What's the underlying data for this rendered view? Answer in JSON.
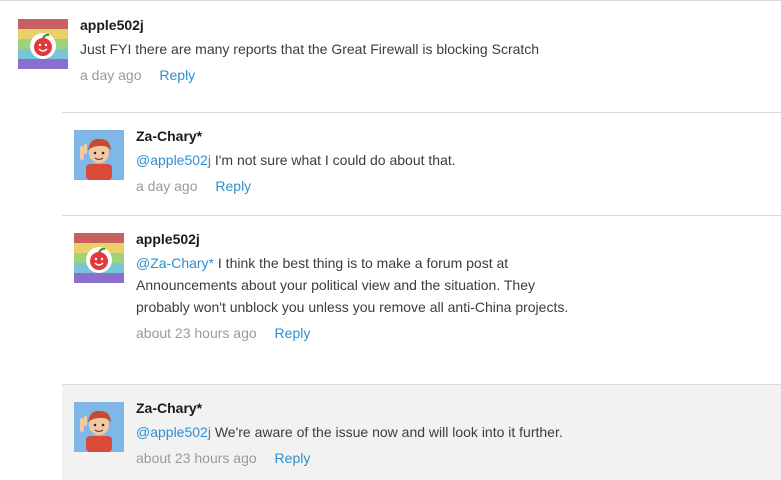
{
  "comments": {
    "top": {
      "username": "apple502j",
      "text": "Just FYI there are many reports that the Great Firewall is blocking Scratch",
      "time": "a day ago",
      "reply_label": "Reply"
    },
    "replies": [
      {
        "username": "Za-Chary*",
        "mention": "@apple502j",
        "text": " I'm not sure what I could do about that.",
        "time": "a day ago",
        "reply_label": "Reply"
      },
      {
        "username": "apple502j",
        "mention": "@Za-Chary*",
        "text": " I think the best thing is to make a forum post at Announcements about your political view and the situation. They probably won't unblock you unless you remove all anti-China projects.",
        "time": "about 23 hours ago",
        "reply_label": "Reply"
      },
      {
        "username": "Za-Chary*",
        "mention": "@apple502j",
        "text": " We're aware of the issue now and will look into it further.",
        "time": "about 23 hours ago",
        "reply_label": "Reply"
      }
    ]
  },
  "avatars": {
    "apple502j": {
      "icon": "rainbow-apple-avatar",
      "stripes": [
        "#c9605f",
        "#e9d16a",
        "#9fd27c",
        "#79c4d9",
        "#8a6fcf"
      ]
    },
    "zachary": {
      "icon": "peace-sign-boy-avatar",
      "background": "#7fb7e6",
      "hair": "#c94a2a",
      "shirt": "#d84a3a"
    }
  }
}
